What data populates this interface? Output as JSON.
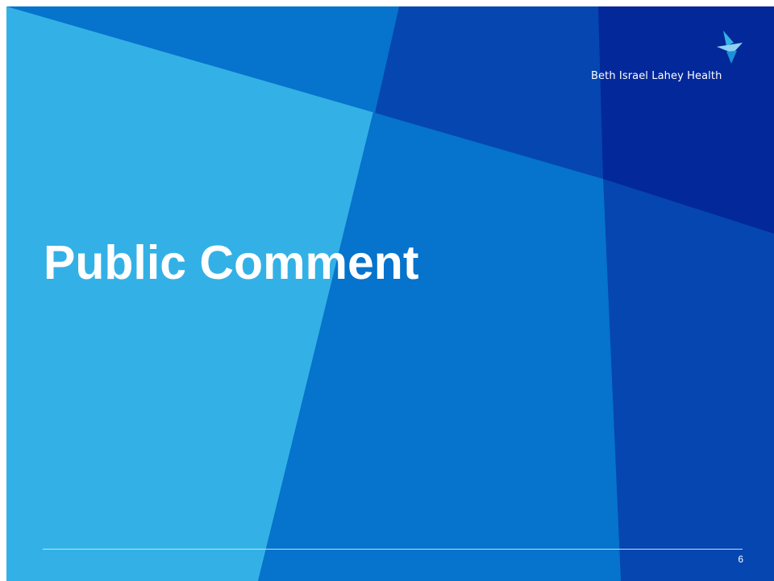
{
  "slide": {
    "title": "Public Comment",
    "page_number": "6"
  },
  "logo": {
    "text": "Beth Israel Lahey Health",
    "icon": "bird-logo-icon"
  },
  "colors": {
    "light_blue": "#33b1e6",
    "mid_blue": "#0673cc",
    "royal_blue": "#0546b0",
    "deep_blue": "#03289a",
    "bright_blue": "#1c72d3",
    "frame": "#ffffff",
    "text": "#ffffff"
  }
}
